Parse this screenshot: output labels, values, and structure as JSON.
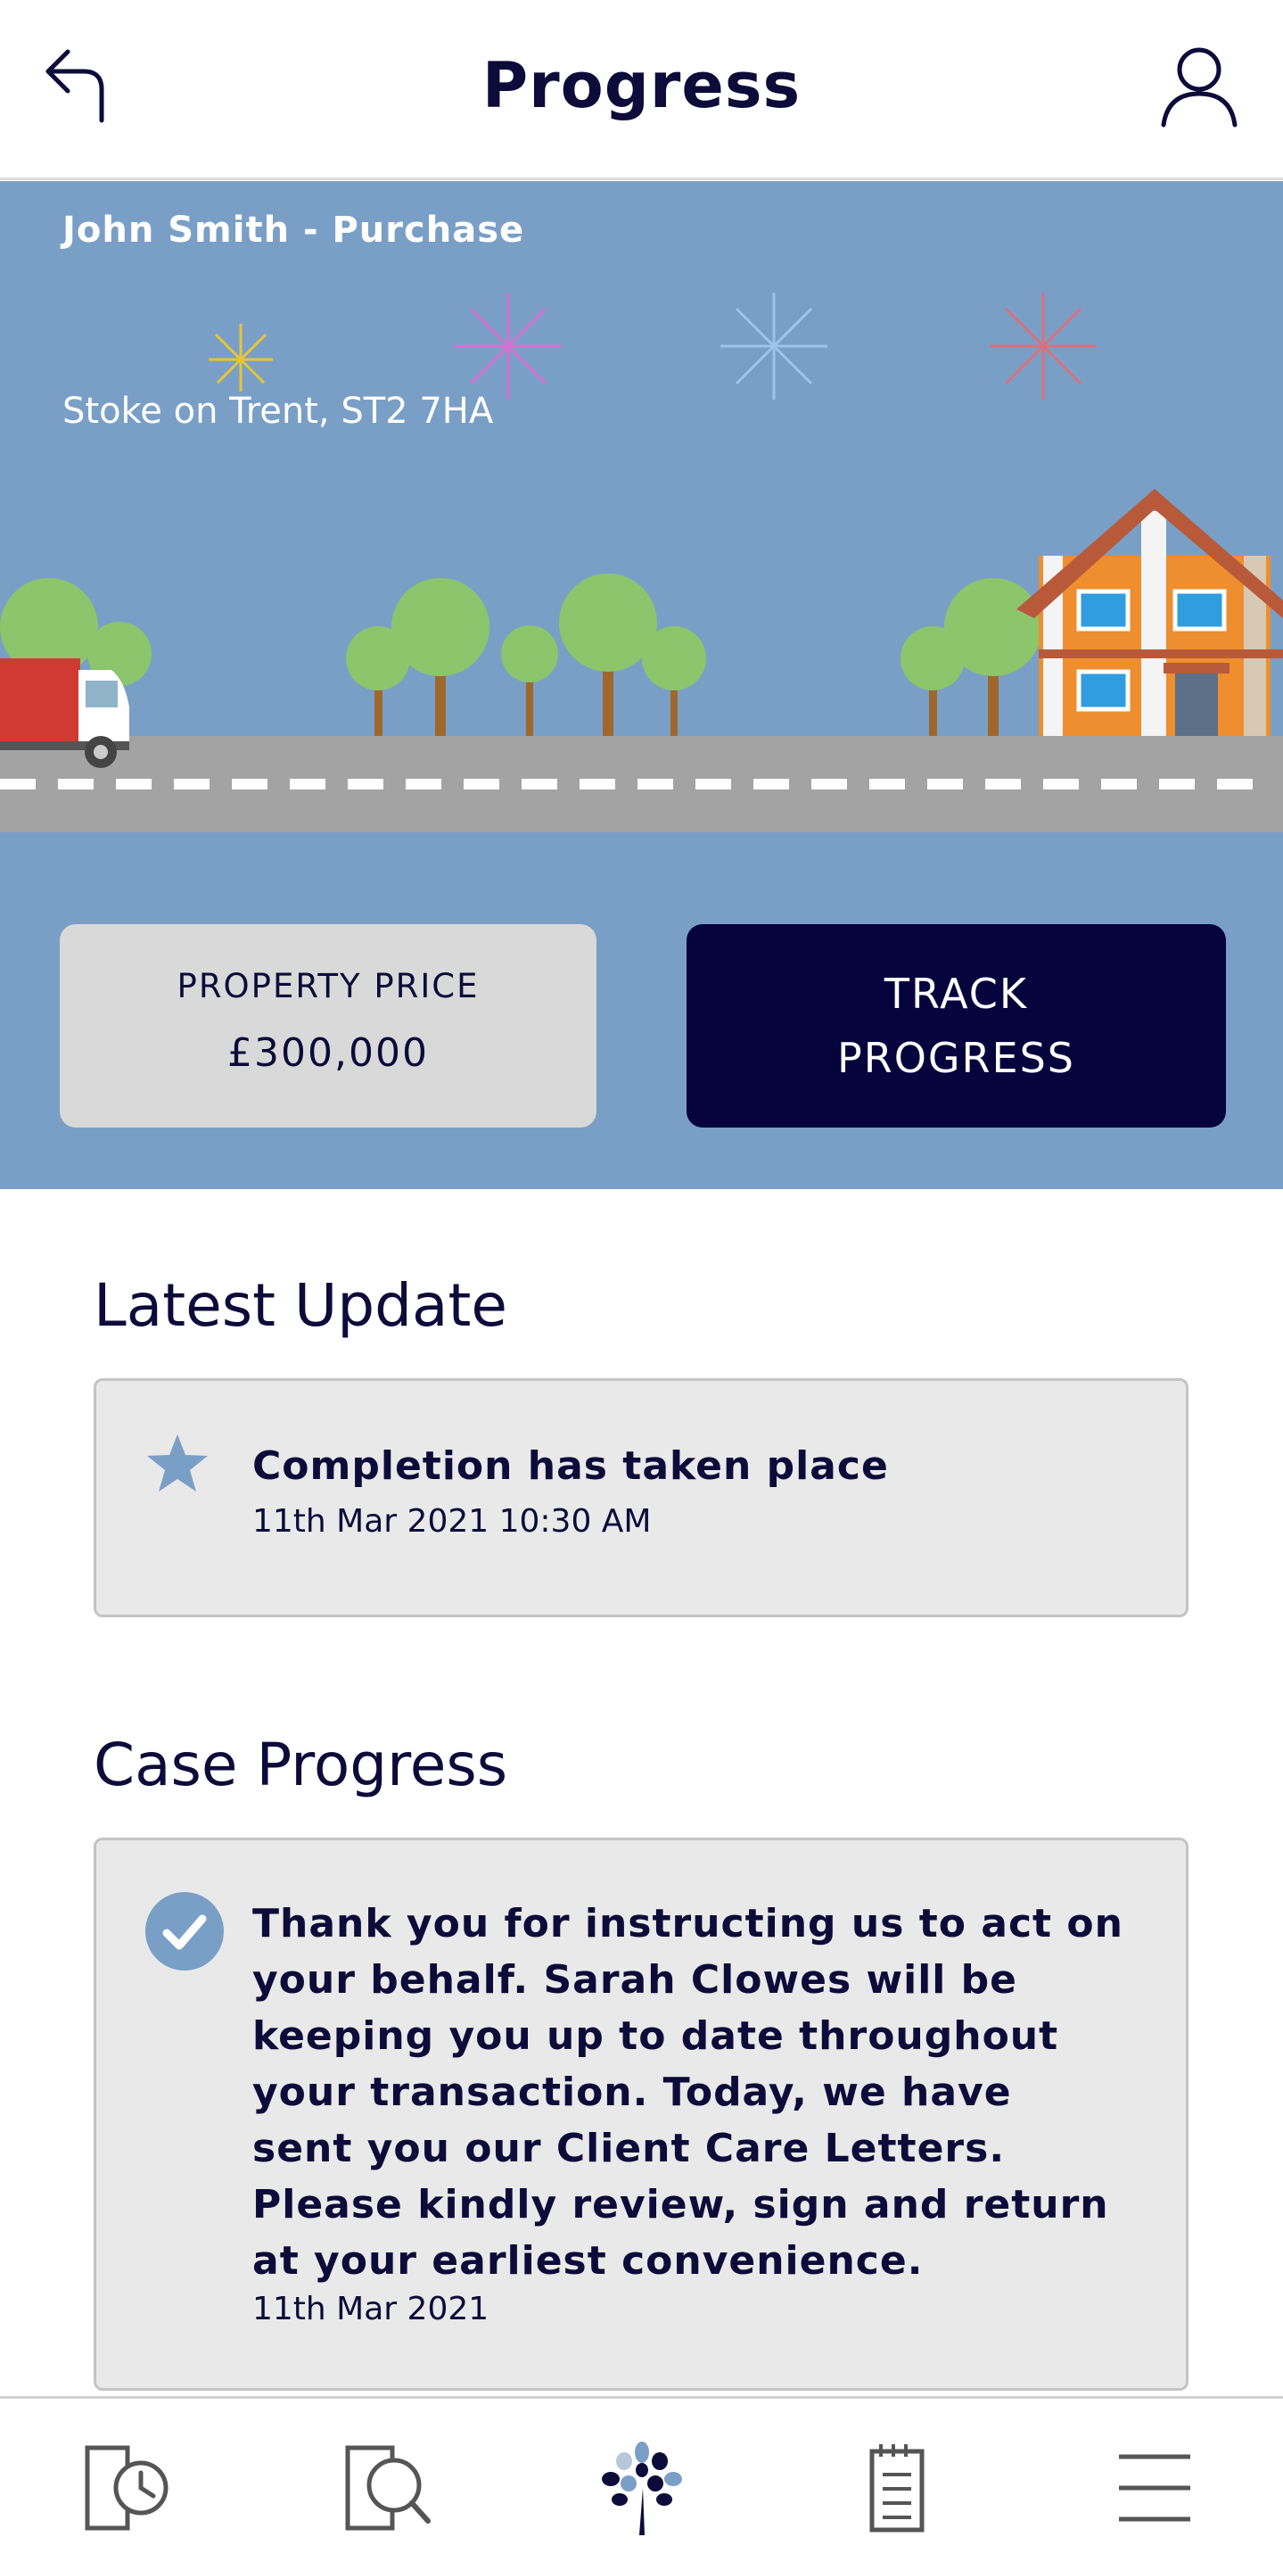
{
  "header": {
    "title": "Progress"
  },
  "hero": {
    "case_title": "John Smith - Purchase",
    "address": "Stoke on Trent, ST2 7HA",
    "price_label": "PROPERTY PRICE",
    "price_value": "£300,000",
    "track_label": "TRACK PROGRESS",
    "colors": {
      "background": "#7a9fc7",
      "track_button": "#06033d"
    }
  },
  "latest_update": {
    "heading": "Latest Update",
    "title": "Completion has taken place",
    "date": "11th Mar 2021 10:30 AM",
    "icon": "star-icon"
  },
  "case_progress": {
    "heading": "Case Progress",
    "text": "Thank you for instructing us to act on your behalf.  Sarah Clowes will be keeping you up to date throughout your transaction.  Today, we have sent you our Client Care Letters.  Please kindly review, sign and return at your earliest convenience.",
    "date": "11th Mar 2021",
    "icon": "check-circle-icon"
  },
  "bottom_nav": [
    {
      "icon": "document-clock-icon"
    },
    {
      "icon": "document-search-icon"
    },
    {
      "icon": "tree-logo-icon"
    },
    {
      "icon": "notepad-icon"
    },
    {
      "icon": "menu-icon"
    }
  ]
}
